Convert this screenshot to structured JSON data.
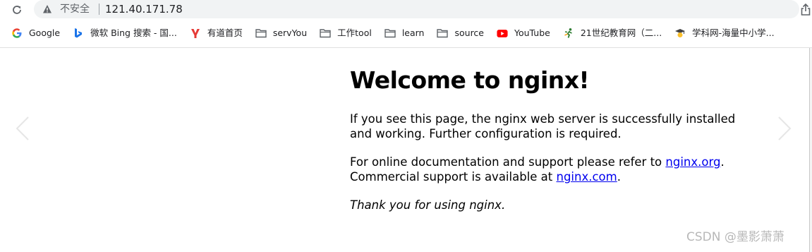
{
  "toolbar": {
    "reload_icon": "reload-icon",
    "security_icon": "warning-triangle-icon",
    "security_label": "不安全",
    "url": "121.40.171.78",
    "share_icon": "share-icon"
  },
  "bookmarks": [
    {
      "label": "Google",
      "icon": "google-icon"
    },
    {
      "label": "微软 Bing 搜索 - 国...",
      "icon": "bing-icon"
    },
    {
      "label": "有道首页",
      "icon": "youdao-icon"
    },
    {
      "label": "servYou",
      "icon": "folder-icon"
    },
    {
      "label": "工作tool",
      "icon": "folder-icon"
    },
    {
      "label": "learn",
      "icon": "folder-icon"
    },
    {
      "label": "source",
      "icon": "folder-icon"
    },
    {
      "label": "YouTube",
      "icon": "youtube-icon"
    },
    {
      "label": "21世纪教育网（二...",
      "icon": "runner-icon"
    },
    {
      "label": "学科网-海量中小学...",
      "icon": "graduate-icon"
    }
  ],
  "page": {
    "title": "Welcome to nginx!",
    "p1": "If you see this page, the nginx web server is successfully installed and working. Further configuration is required.",
    "p2_before": "For online documentation and support please refer to ",
    "link_org": "nginx.org",
    "p2_middle": ".",
    "p2_line2": "Commercial support is available at ",
    "link_com": "nginx.com",
    "p2_after": ".",
    "p3": "Thank you for using nginx."
  },
  "watermark": "CSDN @墨影萧萧",
  "colors": {
    "link": "#0000ee",
    "omnibox": "#f1f3f4",
    "youtube_red": "#ff0000",
    "bing_blue": "#1a73e8"
  }
}
